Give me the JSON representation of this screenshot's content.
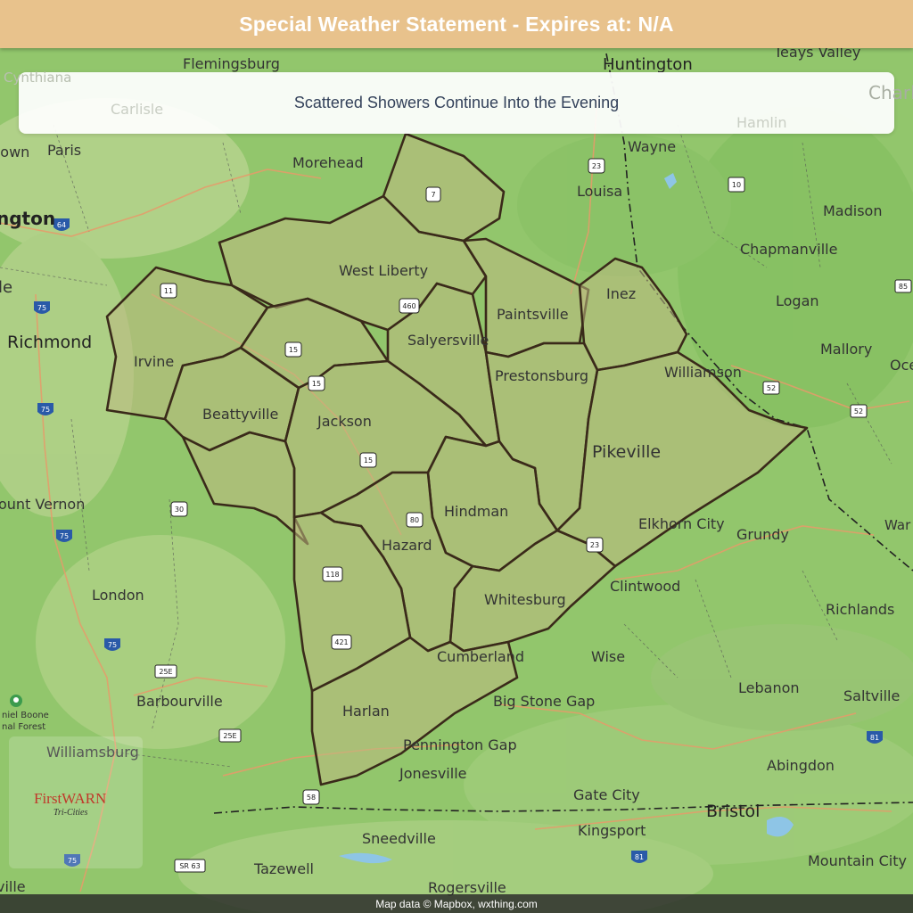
{
  "header": {
    "title": "Special Weather Statement - Expires at: N/A"
  },
  "banner": {
    "text": "Scattered Showers Continue Into the Evening"
  },
  "footer": {
    "attribution": "Map data © Mapbox, wxthing.com"
  },
  "logo": {
    "name": "FirstWARN",
    "subtitle": "Tri-Cities"
  },
  "colors": {
    "header": "#e8c28c",
    "land": "#8fc46a",
    "warning_fill": "#b7b882",
    "county_border": "#3a2a1a"
  },
  "counties": [
    "West Liberty",
    "Paintsville",
    "Inez",
    "Salyersville",
    "Prestonsburg",
    "Pikeville",
    "Jackson",
    "Beattyville",
    "Irvine",
    "Hindman",
    "Hazard",
    "Whitesburg",
    "Harlan",
    "Cumberland"
  ],
  "places": {
    "flemingsburg": "Flemingsburg",
    "huntington": "Huntington",
    "teays_valley": "Teays Valley",
    "cynthiana": "Cynthiana",
    "carlisle": "Carlisle",
    "hamlin": "Hamlin",
    "charl": "Charl",
    "paris": "Paris",
    "town": "town",
    "morehead": "Morehead",
    "wayne": "Wayne",
    "louisa": "Louisa",
    "madison": "Madison",
    "chapmanville": "Chapmanville",
    "logan": "Logan",
    "mallory": "Mallory",
    "oce": "Oce",
    "ngton": "ngton",
    "le": "le",
    "richmond": "Richmond",
    "west_liberty": "West Liberty",
    "paintsville": "Paintsville",
    "inez": "Inez",
    "salyersville": "Salyersville",
    "prestonsburg": "Prestonsburg",
    "williamson": "Williamson",
    "irvine": "Irvine",
    "beattyville": "Beattyville",
    "jackson": "Jackson",
    "pikeville": "Pikeville",
    "mount_vernon": "ount Vernon",
    "hindman": "Hindman",
    "elkhorn_city": "Elkhorn City",
    "grundy": "Grundy",
    "war": "War",
    "hazard": "Hazard",
    "london": "London",
    "clintwood": "Clintwood",
    "whitesburg": "Whitesburg",
    "richlands": "Richlands",
    "wise": "Wise",
    "cumberland": "Cumberland",
    "barbourville": "Barbourville",
    "lebanon": "Lebanon",
    "saltville": "Saltville",
    "big_stone_gap": "Big Stone Gap",
    "daniel_boone": "niel Boone",
    "national_forest": "nal Forest",
    "harlan": "Harlan",
    "williamsburg": "Williamsburg",
    "pennington_gap": "Pennington Gap",
    "abingdon": "Abingdon",
    "jonesville": "Jonesville",
    "gate_city": "Gate City",
    "bristol": "Bristol",
    "kingsport": "Kingsport",
    "sneedville": "Sneedville",
    "mountain_city": "Mountain City",
    "tazewell": "Tazewell",
    "rogersville": "Rogersville",
    "ville": "ville"
  },
  "shields": [
    "7",
    "11",
    "15",
    "15",
    "15",
    "460",
    "23",
    "10",
    "64",
    "75",
    "75",
    "75",
    "75",
    "75",
    "30",
    "80",
    "23",
    "118",
    "421",
    "25E",
    "25E",
    "58",
    "81",
    "81",
    "52",
    "52",
    "85",
    "SR 63"
  ]
}
